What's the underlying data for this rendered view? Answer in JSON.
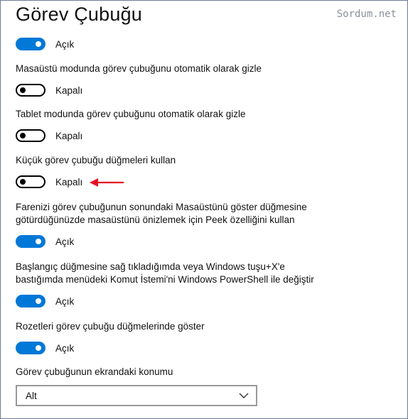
{
  "title": "Görev Çubuğu",
  "watermark": "Sordum.net",
  "settings": [
    {
      "label": "",
      "state": "Açık",
      "on": true
    },
    {
      "label": "Masaüstü modunda görev çubuğunu otomatik olarak gizle",
      "state": "Kapalı",
      "on": false
    },
    {
      "label": "Tablet modunda görev çubuğunu otomatik olarak gizle",
      "state": "Kapalı",
      "on": false
    },
    {
      "label": "Küçük görev çubuğu düğmeleri kullan",
      "state": "Kapalı",
      "on": false
    },
    {
      "label_line1": "Farenizi görev çubuğunun sonundaki Masaüstünü göster düğmesine",
      "label_line2": "götürdüğünüzde masaüstünü önizlemek için Peek özelliğini kullan",
      "state": "Açık",
      "on": true
    },
    {
      "label_line1": "Başlangıç düğmesine sağ tıkladığımda veya Windows tuşu+X'e",
      "label_line2": "bastığımda menüdeki Komut İstemi'ni Windows PowerShell ile değiştir",
      "state": "Açık",
      "on": true
    },
    {
      "label": "Rozetleri görev çubuğu düğmelerinde göster",
      "state": "Açık",
      "on": true
    }
  ],
  "position": {
    "label": "Görev çubuğunun ekrandaki konumu",
    "value": "Alt"
  },
  "colors": {
    "accent": "#0078d7",
    "annotation_arrow": "#e81123"
  },
  "icons": {
    "dropdown": "chevron-down-icon",
    "annotation": "red-arrow-icon"
  }
}
